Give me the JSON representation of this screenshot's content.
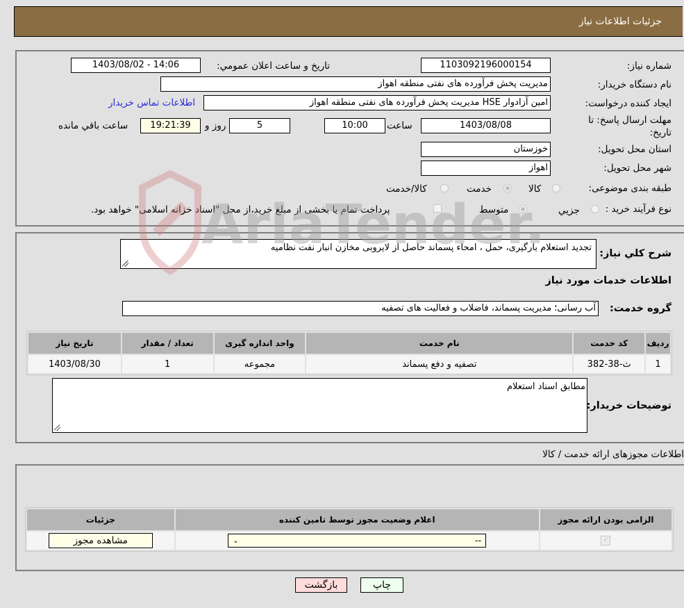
{
  "header": {
    "title": "جزئیات اطلاعات نیاز"
  },
  "form": {
    "need_number": {
      "label": "شماره نیاز:",
      "value": "1103092196000154"
    },
    "announce_datetime": {
      "label": "تاریخ و ساعت اعلان عمومي:",
      "value": "1403/08/02 - 14:06"
    },
    "buyer_org": {
      "label": "نام دستگاه خریدار:",
      "value": "مدیریت پخش فرآورده های نفتی منطقه اهواز"
    },
    "requester": {
      "label": "ایجاد کننده درخواست:",
      "value": "امین آزادوار HSE مدیریت پخش فرآورده های نفتی منطقه اهواز"
    },
    "contact_link": "اطلاعات تماس خریدار",
    "deadline": {
      "label_line1": "مهلت ارسال پاسخ: تا",
      "label_line2": "تاریخ:",
      "date": "1403/08/08",
      "time_label": "ساعت",
      "time": "10:00",
      "days": "5",
      "days_label": "روز و",
      "remaining": "19:21:39",
      "remaining_label": "ساعت باقي مانده"
    },
    "province": {
      "label": "استان محل تحویل:",
      "value": "خوزستان"
    },
    "city": {
      "label": "شهر محل تحویل:",
      "value": "اهواز"
    },
    "category": {
      "label": "طبقه بندی موضوعی:",
      "options": [
        "کالا",
        "خدمت",
        "کالا/خدمت"
      ],
      "selected": "خدمت"
    },
    "process": {
      "label": "نوع فرآیند خرید :",
      "options": [
        "جزيي",
        "متوسط"
      ],
      "selected": "متوسط",
      "treasury_note": "پرداخت تمام یا بخشی از مبلغ خرید،از محل \"اسناد خزانه اسلامی\" خواهد بود.",
      "treasury_checked": false
    }
  },
  "summary": {
    "label": "شرح کلي نیاز:",
    "value": "تجدید استعلام بارگیری، حمل ، امحاء پسماند حاصل از لایروبی مخازن  انبار نفت نظامیه"
  },
  "services": {
    "title": "اطلاعات خدمات مورد نیاز",
    "group_label": "گروه خدمت:",
    "group_value": "آب رسانی؛ مدیریت پسماند، فاضلاب و فعالیت های تصفیه",
    "table": {
      "headers": [
        "ردیف",
        "کد خدمت",
        "نام خدمت",
        "واحد اندازه گیری",
        "تعداد / مقدار",
        "تاریخ نیاز"
      ],
      "rows": [
        [
          "1",
          "ث-38-382",
          "تصفیه و دفع پسماند",
          "مجموعه",
          "1",
          "1403/08/30"
        ]
      ]
    }
  },
  "buyer_notes": {
    "label": "توضیحات خریدار:",
    "value": "مطابق اسناد استعلام"
  },
  "permits": {
    "title": "اطلاعات مجوزهای ارائه خدمت / کالا",
    "headers": [
      "الزامی بودن ارائه مجوز",
      "اعلام وضعیت مجوز توسط تامین کننده",
      "جزئیات"
    ],
    "row": {
      "required_checked": true,
      "status_value": "--",
      "details_button": "مشاهده مجوز"
    }
  },
  "buttons": {
    "print": "چاپ",
    "back": "بازگشت"
  },
  "watermark": {
    "text": "AriaTender.neT"
  }
}
